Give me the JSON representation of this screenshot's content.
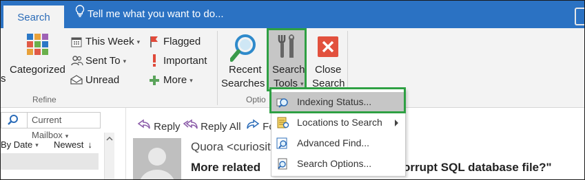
{
  "tabs": {
    "active": "Search",
    "tell_me": "Tell me what you want to do..."
  },
  "ribbon": {
    "categorized": "Categorized",
    "left_cut": "s",
    "refine": {
      "this_week": "This Week",
      "sent_to": "Sent To",
      "unread": "Unread",
      "flagged": "Flagged",
      "important": "Important",
      "more": "More",
      "group_label": "Refine"
    },
    "recent_searches_1": "Recent",
    "recent_searches_2": "Searches",
    "search_tools_1": "Search",
    "search_tools_2": "Tools",
    "close_search_1": "Close",
    "close_search_2": "Search",
    "options_group_label": "Optio"
  },
  "dropdown": {
    "items": [
      {
        "label": "Indexing Status...",
        "icon": "indexing-status-icon",
        "active": true
      },
      {
        "label": "Locations to Search",
        "icon": "locations-icon",
        "has_submenu": true
      },
      {
        "label": "Advanced Find...",
        "icon": "advanced-find-icon"
      },
      {
        "label": "Search Options...",
        "icon": "search-options-icon"
      }
    ]
  },
  "left_pane": {
    "scope": "Current Mailbox",
    "sort_by": "By Date",
    "sort_order": "Newest"
  },
  "reading_pane": {
    "reply": "Reply",
    "reply_all": "Reply All",
    "forward": "Fo",
    "sender": "Quora <curiosit",
    "subject": "More related",
    "subject_tail": "orrupt SQL database file?\""
  },
  "colors": {
    "accent": "#2b72c3",
    "highlight": "#2ea043"
  }
}
